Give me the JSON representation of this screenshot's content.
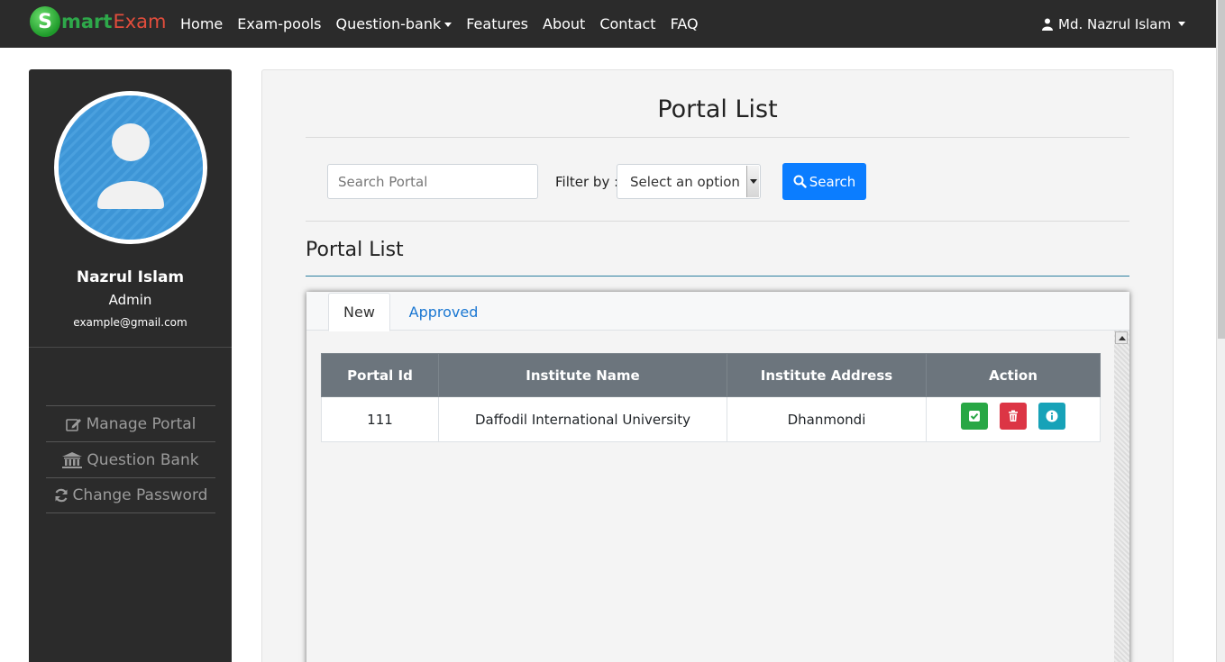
{
  "brand": {
    "letter": "S",
    "part1": "mart",
    "part2": "Exam"
  },
  "nav": {
    "items": [
      {
        "label": "Home",
        "dropdown": false
      },
      {
        "label": "Exam-pools",
        "dropdown": false
      },
      {
        "label": "Question-bank",
        "dropdown": true
      },
      {
        "label": "Features",
        "dropdown": false
      },
      {
        "label": "About",
        "dropdown": false
      },
      {
        "label": "Contact",
        "dropdown": false
      },
      {
        "label": "FAQ",
        "dropdown": false
      }
    ],
    "user": "Md. Nazrul Islam"
  },
  "sidebar": {
    "name": "Nazrul Islam",
    "role": "Admin",
    "email": "example@gmail.com",
    "menu": [
      {
        "label": "Manage Portal",
        "icon": "edit-icon"
      },
      {
        "label": "Question Bank",
        "icon": "bank-icon"
      },
      {
        "label": "Change Password",
        "icon": "refresh-icon"
      }
    ]
  },
  "main": {
    "title": "Portal List",
    "search": {
      "placeholder": "Search Portal",
      "value": ""
    },
    "filter": {
      "label": "Filter by :",
      "selected": "Select an option"
    },
    "search_button": "Search",
    "subtitle": "Portal List",
    "tabs": [
      {
        "label": "New",
        "active": true
      },
      {
        "label": "Approved",
        "active": false
      }
    ],
    "table": {
      "headers": [
        "Portal Id",
        "Institute Name",
        "Institute Address",
        "Action"
      ],
      "rows": [
        {
          "id": "111",
          "name": "Daffodil International University",
          "address": "Dhanmondi"
        }
      ]
    }
  },
  "colors": {
    "navbar": "#2b2b2b",
    "primary": "#0b7dff",
    "success": "#28a745",
    "danger": "#dc3545",
    "info": "#17a2b8",
    "table_header": "#6c757d",
    "avatar": "#3d95d6"
  }
}
